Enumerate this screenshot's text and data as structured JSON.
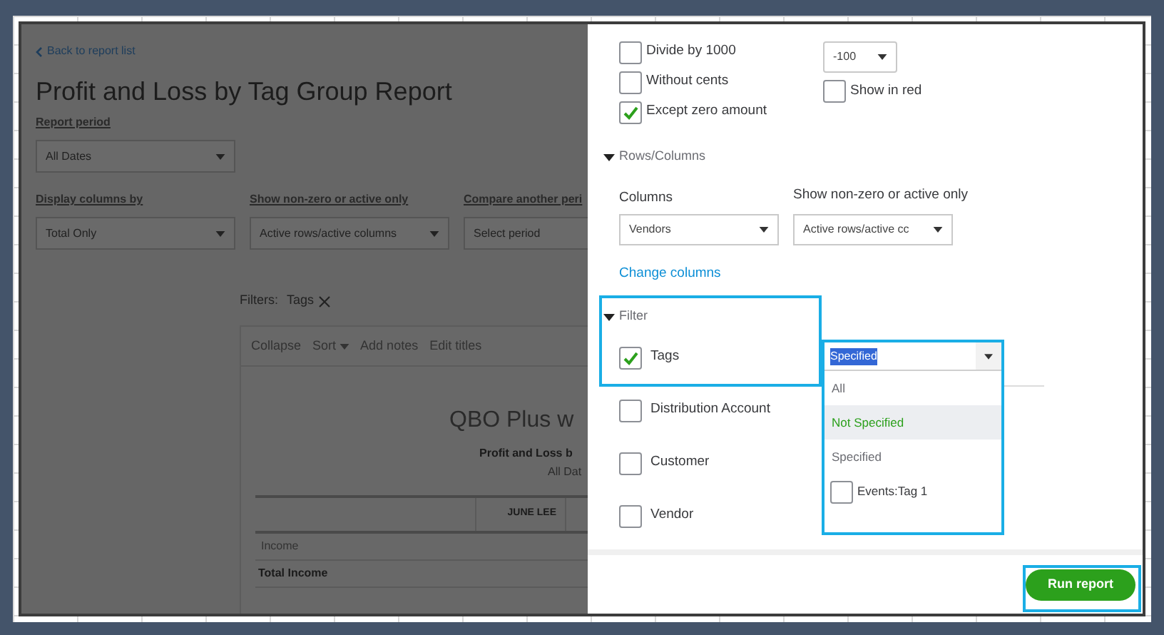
{
  "page": {
    "back_link": "Back to report list",
    "title": "Profit and Loss by Tag Group Report",
    "report_period": {
      "label": "Report period",
      "value": "All Dates"
    },
    "controls": [
      {
        "label": "Display columns by",
        "value": "Total Only"
      },
      {
        "label": "Show non-zero or active only",
        "value": "Active rows/active columns"
      },
      {
        "label": "Compare another peri",
        "value": "Select period"
      }
    ],
    "filters": {
      "label": "Filters:",
      "tag": "Tags"
    },
    "toolbar": [
      {
        "label": "Collapse",
        "kind": "link"
      },
      {
        "label": "Sort",
        "kind": "menu"
      },
      {
        "label": "Add notes",
        "kind": "link"
      },
      {
        "label": "Edit titles",
        "kind": "link"
      }
    ],
    "report": {
      "company": "QBO Plus w",
      "title": "Profit and Loss b",
      "period": "All Dat",
      "columns": [
        "JUNE LEE"
      ],
      "rows": [
        {
          "label": "Income",
          "kind": "section"
        },
        {
          "label": "Total Income",
          "kind": "total"
        }
      ]
    }
  },
  "panel": {
    "number_format": [
      {
        "label": "Divide by 1000",
        "checked": false
      },
      {
        "label": "Without cents",
        "checked": false
      },
      {
        "label": "Except zero amount",
        "checked": true
      }
    ],
    "negative_numbers": {
      "value": "-100",
      "show_in_red": {
        "label": "Show in red",
        "checked": false
      }
    },
    "rows_columns": {
      "title": "Rows/Columns",
      "expanded": true,
      "columns": {
        "label": "Columns",
        "value": "Vendors"
      },
      "non_zero": {
        "label": "Show non-zero or active only",
        "value": "Active rows/active cc"
      },
      "link": "Change columns"
    },
    "filter": {
      "title": "Filter",
      "expanded": true,
      "items": [
        {
          "label": "Tags",
          "checked": true
        },
        {
          "label": "Distribution Account",
          "checked": false
        },
        {
          "label": "Customer",
          "checked": false
        },
        {
          "label": "Vendor",
          "checked": false
        }
      ]
    },
    "tags_dropdown": {
      "value": "Specified",
      "options": [
        {
          "label": "All",
          "kind": "option",
          "highlighted": false
        },
        {
          "label": "Not Specified",
          "kind": "option",
          "highlighted": true
        },
        {
          "label": "Specified",
          "kind": "option",
          "highlighted": false
        },
        {
          "label": "Events:Tag 1",
          "kind": "checkbox",
          "checked": false
        }
      ]
    },
    "run_button": "Run report"
  }
}
